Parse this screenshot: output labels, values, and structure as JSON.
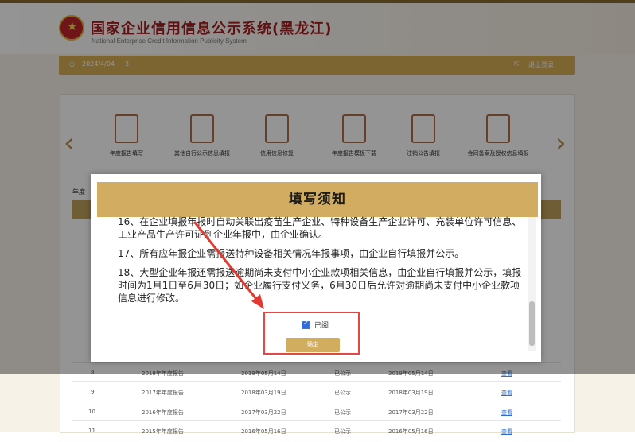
{
  "header": {
    "title": "国家企业信用信息公示系统(黑龙江)",
    "subtitle": "National Enterprise Credit Information Publicity System"
  },
  "top_bar": {
    "date": "2024/4/04",
    "left_mark": "3",
    "logout": "退出登录"
  },
  "carousel": {
    "items": [
      {
        "label": "年度报告填写"
      },
      {
        "label": "其他自行公示信息填报"
      },
      {
        "label": "信用信息修复"
      },
      {
        "label": "年度报告模板下载"
      },
      {
        "label": "注销公告填报"
      },
      {
        "label": "合同备案及授权信息填报"
      }
    ]
  },
  "table": {
    "label": "年度",
    "rows": [
      {
        "no": "8",
        "report": "2018年年度报告",
        "submit_date": "2019年05月14日",
        "status": "已公示",
        "public_date": "2019年05月14日",
        "action": "查看"
      },
      {
        "no": "9",
        "report": "2017年年度报告",
        "submit_date": "2018年03月19日",
        "status": "已公示",
        "public_date": "2018年03月19日",
        "action": "查看"
      },
      {
        "no": "10",
        "report": "2016年年度报告",
        "submit_date": "2017年03月22日",
        "status": "已公示",
        "public_date": "2017年03月22日",
        "action": "查看"
      },
      {
        "no": "11",
        "report": "2015年年度报告",
        "submit_date": "2016年05月16日",
        "status": "已公示",
        "public_date": "2016年05月16日",
        "action": "查看"
      }
    ]
  },
  "modal": {
    "title": "填写须知",
    "items": [
      "16、在企业填报年报时自动关联出疫苗生产企业、特种设备生产企业许可、充装单位许可信息、工业产品生产许可证到企业年报中，由企业确认。",
      "17、所有应年报企业需报送特种设备相关情况年报事项，由企业自行填报并公示。",
      "18、大型企业年报还需报送逾期尚未支付中小企业款项相关信息，由企业自行填报并公示，填报时间为1月1日至6月30日；如企业履行支付义务，6月30日后允许对逾期尚未支付中小企业款项信息进行修改。"
    ],
    "checkbox_label": "已阅",
    "confirm_label": "确定"
  }
}
